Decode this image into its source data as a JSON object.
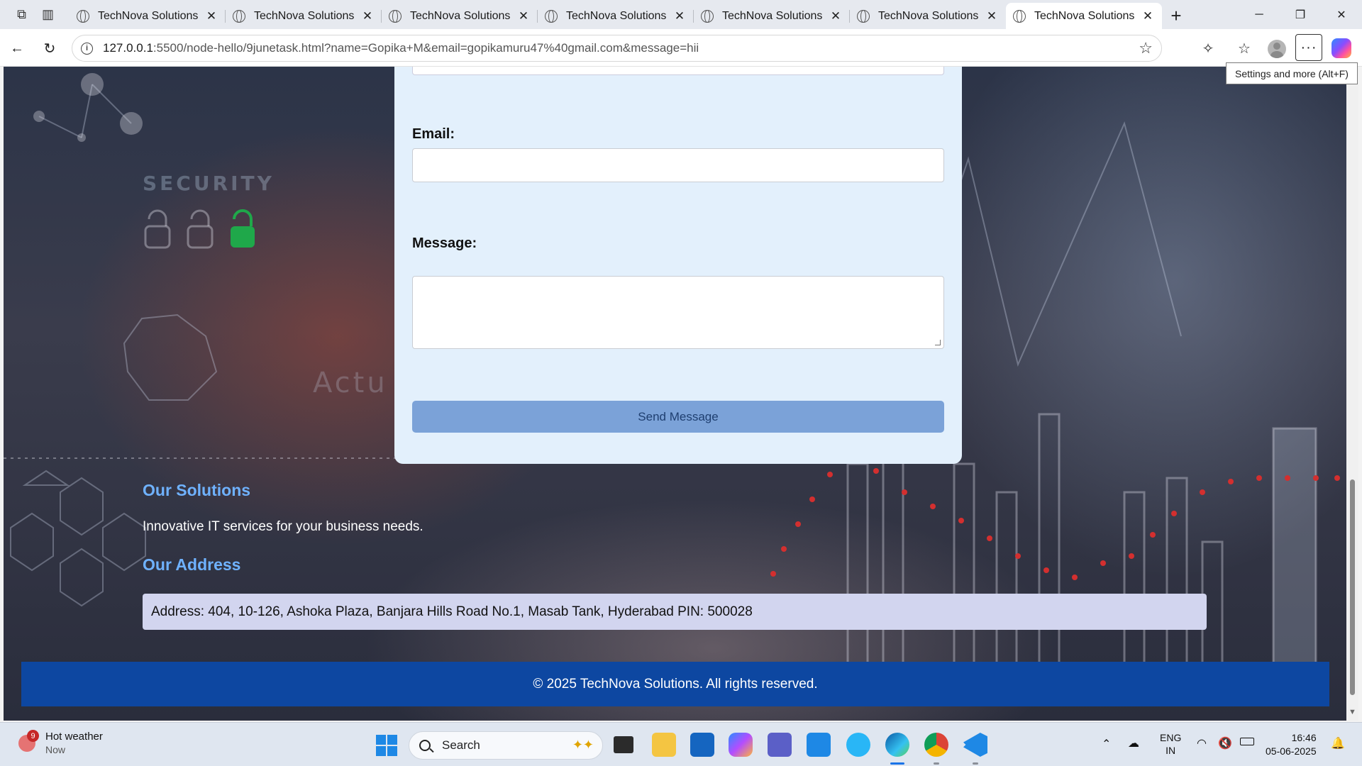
{
  "browser": {
    "tabs": [
      {
        "title": "TechNova Solutions",
        "active": false
      },
      {
        "title": "TechNova Solutions",
        "active": false
      },
      {
        "title": "TechNova Solutions",
        "active": false
      },
      {
        "title": "TechNova Solutions",
        "active": false
      },
      {
        "title": "TechNova Solutions",
        "active": false
      },
      {
        "title": "TechNova Solutions",
        "active": false
      },
      {
        "title": "TechNova Solutions",
        "active": true
      }
    ],
    "url_host": "127.0.0.1",
    "url_rest": ":5500/node-hello/9junetask.html?name=Gopika+M&email=gopikamuru47%40gmail.com&message=hii",
    "tooltip": "Settings and more (Alt+F)"
  },
  "page": {
    "background_text": {
      "security": "SECURITY",
      "actu": "Actu"
    },
    "form": {
      "email_label": "Email:",
      "email_value": "",
      "message_label": "Message:",
      "message_value": "",
      "send_label": "Send Message"
    },
    "solutions": {
      "heading": "Our Solutions",
      "text": "Innovative IT services for your business needs."
    },
    "address": {
      "heading": "Our Address",
      "text": "Address: 404, 10-126, Ashoka Plaza, Banjara Hills Road No.1, Masab Tank, Hyderabad PIN: 500028"
    },
    "footer": "© 2025 TechNova Solutions. All rights reserved."
  },
  "taskbar": {
    "weather_title": "Hot weather",
    "weather_sub": "Now",
    "weather_badge": "9",
    "search_placeholder": "Search",
    "lang_1": "ENG",
    "lang_2": "IN",
    "time": "16:46",
    "date": "05-06-2025"
  },
  "colors": {
    "accent_heading": "#6fb2ff",
    "footer_bg": "#0d47a1",
    "button_bg": "#7ba2d8",
    "card_bg": "#e3f0fc",
    "address_bg": "#d2d5ef"
  }
}
